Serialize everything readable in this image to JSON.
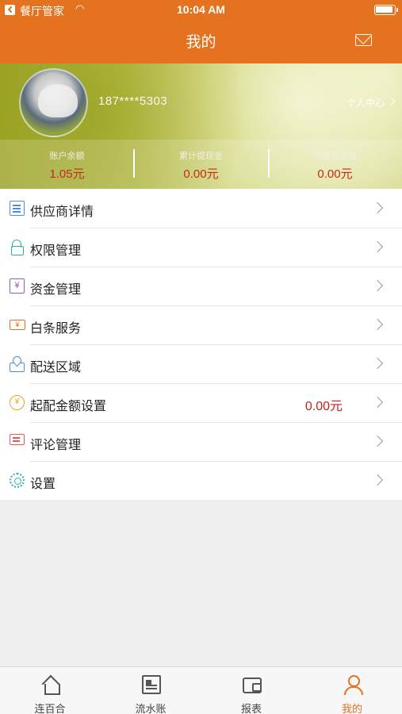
{
  "status_bar": {
    "back_app": "餐厅管家",
    "time": "10:04 AM"
  },
  "header": {
    "title": "我的"
  },
  "profile": {
    "phone": "187****5303",
    "personal_center": "个人中心",
    "stats": [
      {
        "label": "账户余额",
        "value": "1.05元"
      },
      {
        "label": "累计提现金",
        "value": "0.00元"
      },
      {
        "label": "可提现金额",
        "value": "0.00元"
      }
    ]
  },
  "menu": [
    {
      "label": "供应商详情",
      "icon": "document-icon"
    },
    {
      "label": "权限管理",
      "icon": "lock-icon"
    },
    {
      "label": "资金管理",
      "icon": "yen-icon"
    },
    {
      "label": "白条服务",
      "icon": "ticket-icon"
    },
    {
      "label": "配送区域",
      "icon": "map-pin-icon"
    },
    {
      "label": "起配金额设置",
      "icon": "coin-icon",
      "value": "0.00元"
    },
    {
      "label": "评论管理",
      "icon": "chat-icon"
    },
    {
      "label": "设置",
      "icon": "gear-icon"
    }
  ],
  "tabbar": [
    {
      "label": "连百合",
      "icon": "home-icon"
    },
    {
      "label": "流水账",
      "icon": "newspaper-icon"
    },
    {
      "label": "报表",
      "icon": "wallet-icon"
    },
    {
      "label": "我的",
      "icon": "user-icon",
      "active": true
    }
  ],
  "colors": {
    "accent": "#e4721f",
    "amount": "#c42b1f"
  }
}
